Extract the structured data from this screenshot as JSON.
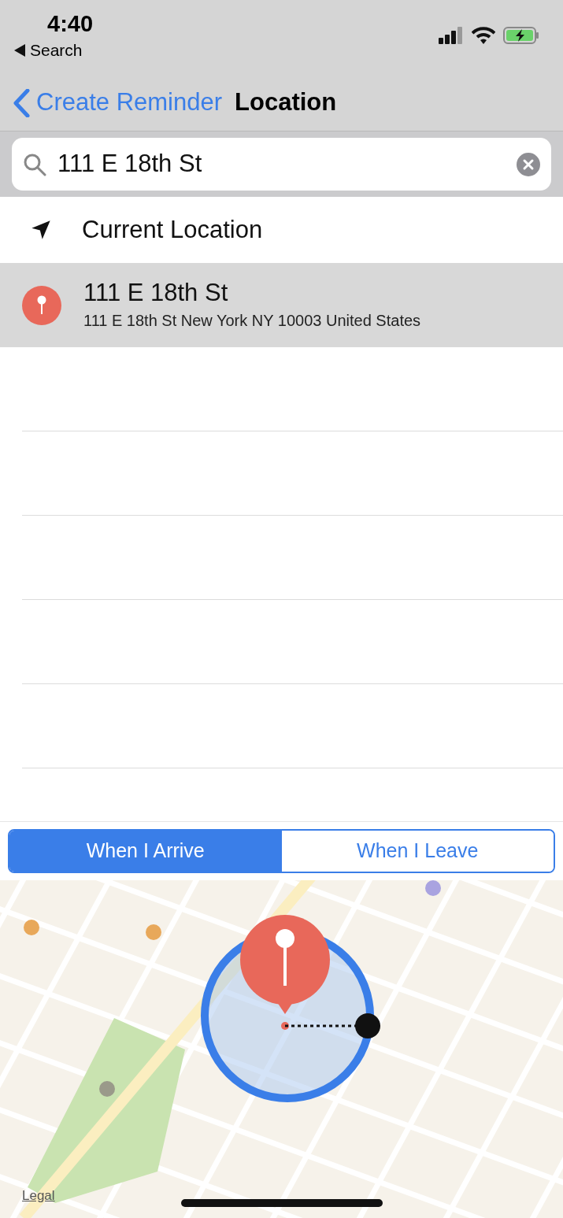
{
  "status_bar": {
    "time": "4:40",
    "back_link": "Search"
  },
  "nav": {
    "back": "Create Reminder",
    "title": "Location"
  },
  "search": {
    "value": "111 E 18th St"
  },
  "results": [
    {
      "kind": "current",
      "title": "Current Location",
      "selected": false
    },
    {
      "kind": "place",
      "title": "111 E 18th St",
      "subtitle": "111 E 18th St New York NY 10003 United States",
      "selected": true
    }
  ],
  "segments": [
    {
      "label": "When I Arrive",
      "selected": true
    },
    {
      "label": "When I Leave",
      "selected": false
    }
  ],
  "map": {
    "kind": "picture",
    "legal": "Legal"
  }
}
